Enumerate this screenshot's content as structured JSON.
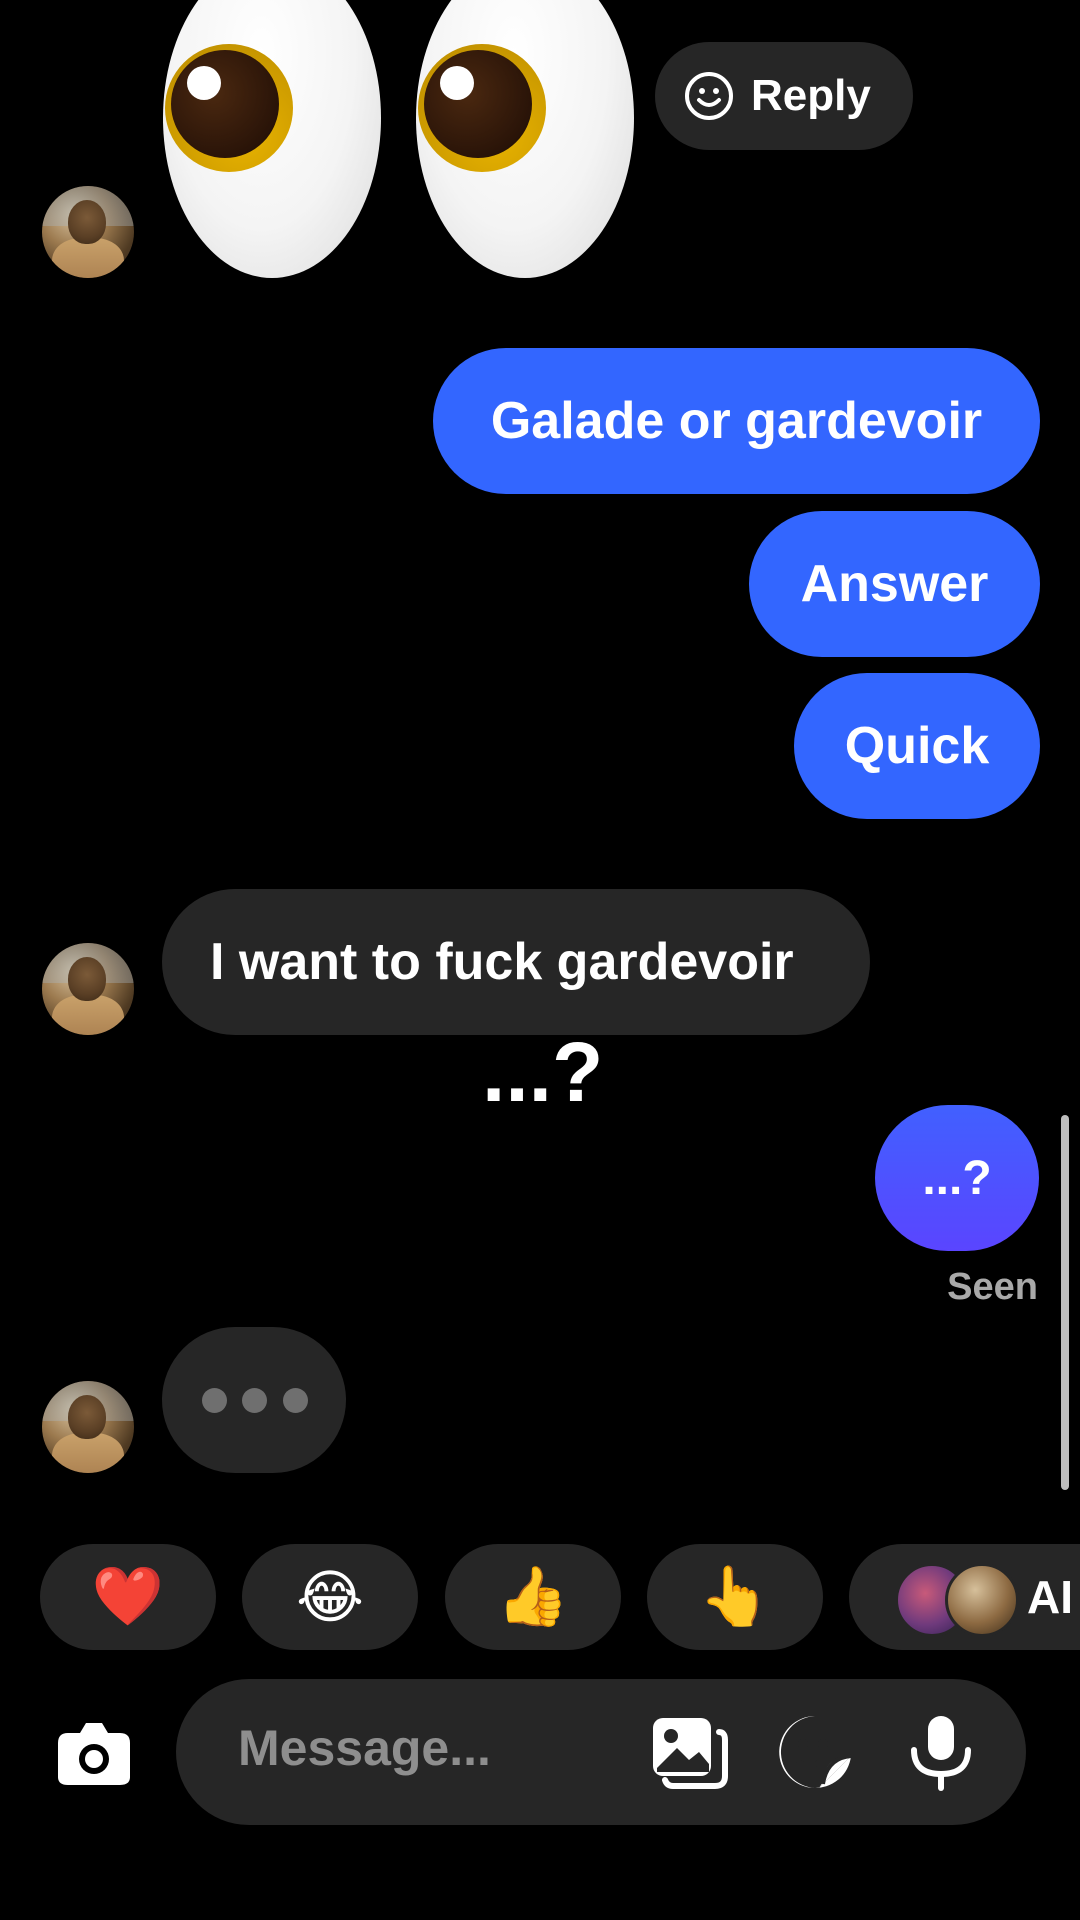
{
  "thread": {
    "reply_chip_label": "Reply",
    "outgoing": [
      {
        "text": "Galade or gardevoir"
      },
      {
        "text": "Answer"
      },
      {
        "text": "Quick"
      }
    ],
    "incoming_message": "I want to fuck gardevoir",
    "floating_text": "...?",
    "last_outgoing": "...?",
    "seen_label": "Seen"
  },
  "reactions": [
    {
      "emoji": "❤️",
      "name": "heart"
    },
    {
      "emoji": "😂",
      "name": "tears-of-joy"
    },
    {
      "emoji": "👍",
      "name": "thumbs-up"
    },
    {
      "emoji": "👆",
      "name": "pointing-finger"
    }
  ],
  "ai_chip_label": "AI",
  "composer": {
    "placeholder": "Message..."
  },
  "icons": {
    "camera": "camera-icon",
    "gallery": "gallery-icon",
    "sticker": "sticker-icon",
    "mic": "microphone-icon",
    "smiley": "smiley-icon"
  },
  "colors": {
    "outgoing_bubble": "#3366ff",
    "outgoing_last_bubble": "#4a55ff",
    "incoming_bubble": "#262626",
    "background": "#000000"
  }
}
